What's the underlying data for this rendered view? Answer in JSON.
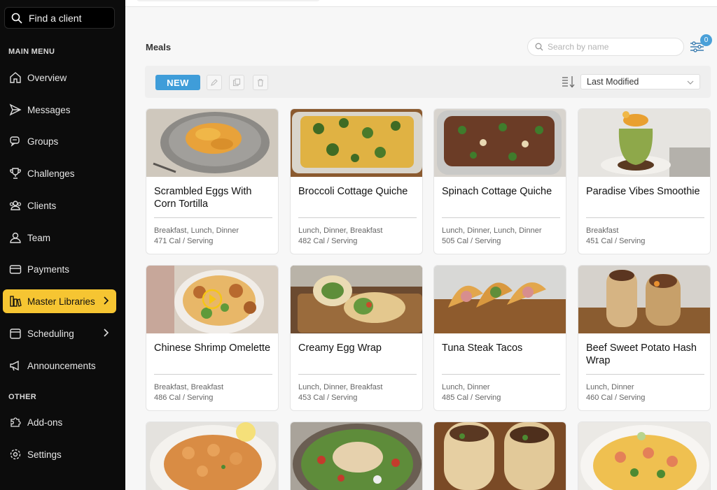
{
  "sidebar": {
    "find_client": "Find a client",
    "main_menu_label": "MAIN MENU",
    "other_label": "OTHER",
    "items": [
      {
        "label": "Overview",
        "icon": "home-icon"
      },
      {
        "label": "Messages",
        "icon": "send-icon"
      },
      {
        "label": "Groups",
        "icon": "chat-icon"
      },
      {
        "label": "Challenges",
        "icon": "trophy-icon"
      },
      {
        "label": "Clients",
        "icon": "users-icon"
      },
      {
        "label": "Team",
        "icon": "user-icon"
      },
      {
        "label": "Payments",
        "icon": "card-icon"
      },
      {
        "label": "Master Libraries",
        "icon": "library-icon",
        "active": true
      },
      {
        "label": "Scheduling",
        "icon": "calendar-icon"
      },
      {
        "label": "Announcements",
        "icon": "megaphone-icon"
      }
    ],
    "other_items": [
      {
        "label": "Add-ons",
        "icon": "puzzle-icon"
      },
      {
        "label": "Settings",
        "icon": "gear-icon"
      }
    ],
    "accent_color": "#f6c532"
  },
  "main": {
    "title": "Meals",
    "search_placeholder": "Search by name",
    "filter_count": "0",
    "new_button": "NEW",
    "sort_value": "Last Modified",
    "new_button_color": "#3f9dd9"
  },
  "meals": [
    {
      "name": "Scrambled Eggs With Corn Tortilla",
      "tags": "Breakfast, Lunch, Dinner",
      "cal": "471 Cal / Serving"
    },
    {
      "name": "Broccoli Cottage Quiche",
      "tags": "Lunch, Dinner, Breakfast",
      "cal": "482 Cal / Serving"
    },
    {
      "name": "Spinach Cottage Quiche",
      "tags": "Lunch, Dinner, Lunch, Dinner",
      "cal": "505 Cal / Serving"
    },
    {
      "name": "Paradise Vibes Smoothie",
      "tags": "Breakfast",
      "cal": "451 Cal / Serving"
    },
    {
      "name": "Chinese Shrimp Omelette",
      "tags": "Breakfast, Breakfast",
      "cal": "486 Cal / Serving"
    },
    {
      "name": "Creamy Egg Wrap",
      "tags": "Lunch, Dinner, Breakfast",
      "cal": "453 Cal / Serving"
    },
    {
      "name": "Tuna Steak Tacos",
      "tags": "Lunch, Dinner",
      "cal": "485 Cal / Serving"
    },
    {
      "name": "Beef Sweet Potato Hash Wrap",
      "tags": "Lunch, Dinner",
      "cal": "460 Cal / Serving"
    }
  ]
}
